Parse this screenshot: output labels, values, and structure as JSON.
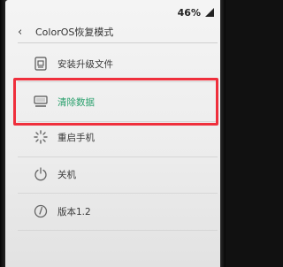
{
  "status_bar": {
    "battery_percent": "46%"
  },
  "header": {
    "title": "ColorOS恢复模式",
    "back_icon": "chevron-left-icon"
  },
  "menu": {
    "items": [
      {
        "label": "安装升级文件",
        "icon": "install-package-icon"
      },
      {
        "label": "清除数据",
        "icon": "clear-data-icon",
        "selected": true
      },
      {
        "label": "重启手机",
        "icon": "restart-icon"
      },
      {
        "label": "关机",
        "icon": "power-icon"
      },
      {
        "label": "版本1.2",
        "icon": "info-icon"
      }
    ]
  },
  "colors": {
    "selected_text": "#2aa06d",
    "highlight_border": "#ef2f3c"
  }
}
